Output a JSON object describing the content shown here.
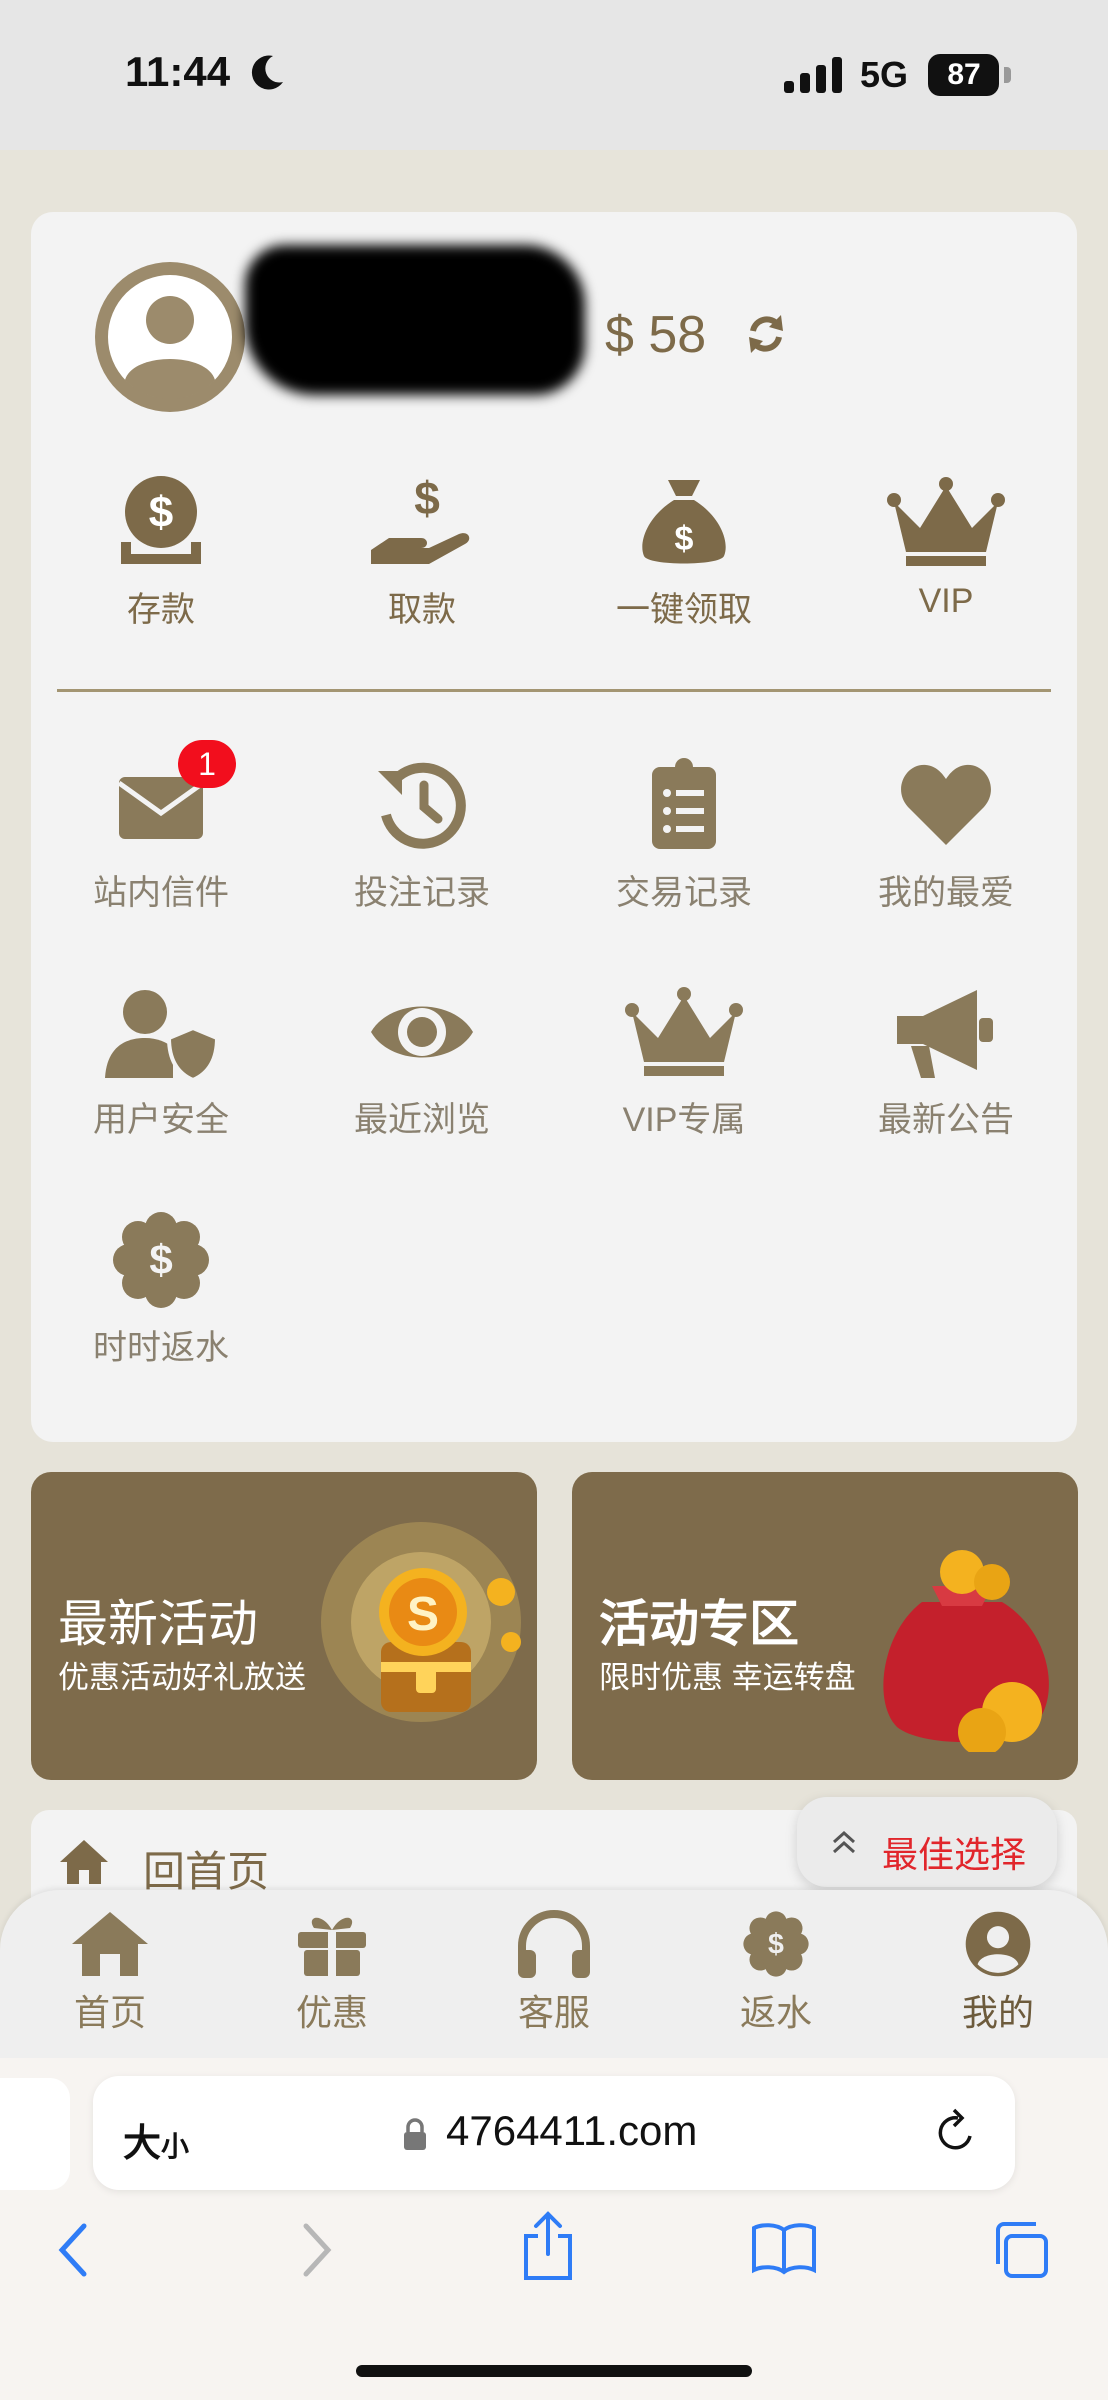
{
  "status_bar": {
    "time": "11:44",
    "network": "5G",
    "battery": "87",
    "battery_level": 0.87
  },
  "account": {
    "balance": "$ 58"
  },
  "quick_actions": [
    {
      "label": "存款",
      "icon": "deposit-icon"
    },
    {
      "label": "取款",
      "icon": "withdraw-icon"
    },
    {
      "label": "一键领取",
      "icon": "money-bag-icon"
    },
    {
      "label": "VIP",
      "icon": "crown-icon"
    }
  ],
  "menu": [
    {
      "label": "站内信件",
      "icon": "mail-icon",
      "badge": "1"
    },
    {
      "label": "投注记录",
      "icon": "history-icon"
    },
    {
      "label": "交易记录",
      "icon": "clipboard-list-icon"
    },
    {
      "label": "我的最爱",
      "icon": "heart-icon"
    },
    {
      "label": "用户安全",
      "icon": "user-shield-icon"
    },
    {
      "label": "最近浏览",
      "icon": "eye-icon"
    },
    {
      "label": "VIP专属",
      "icon": "crown-icon"
    },
    {
      "label": "最新公告",
      "icon": "megaphone-icon"
    },
    {
      "label": "时时返水",
      "icon": "rebate-icon"
    }
  ],
  "banners": [
    {
      "title": "最新活动",
      "subtitle": "优惠活动好礼放送",
      "image": "treasure-chest-coin"
    },
    {
      "title": "活动专区",
      "subtitle": "限时优惠 幸运转盘",
      "image": "red-coin-bag"
    }
  ],
  "home_link": {
    "label": "回首页"
  },
  "best_choice": {
    "label": "最佳选择"
  },
  "bottom_nav": [
    {
      "label": "首页",
      "icon": "home-icon"
    },
    {
      "label": "优惠",
      "icon": "gift-icon"
    },
    {
      "label": "客服",
      "icon": "headphones-icon"
    },
    {
      "label": "返水",
      "icon": "rebate-icon"
    },
    {
      "label": "我的",
      "icon": "user-circle-icon"
    }
  ],
  "browser": {
    "text_size": "大",
    "text_size_small": "小",
    "url": "4764411.com"
  },
  "colors": {
    "brand": "#7e6b4b",
    "accent_red": "#e1262b",
    "badge": "#f20e1d",
    "ios_blue": "#2f7cf6"
  }
}
